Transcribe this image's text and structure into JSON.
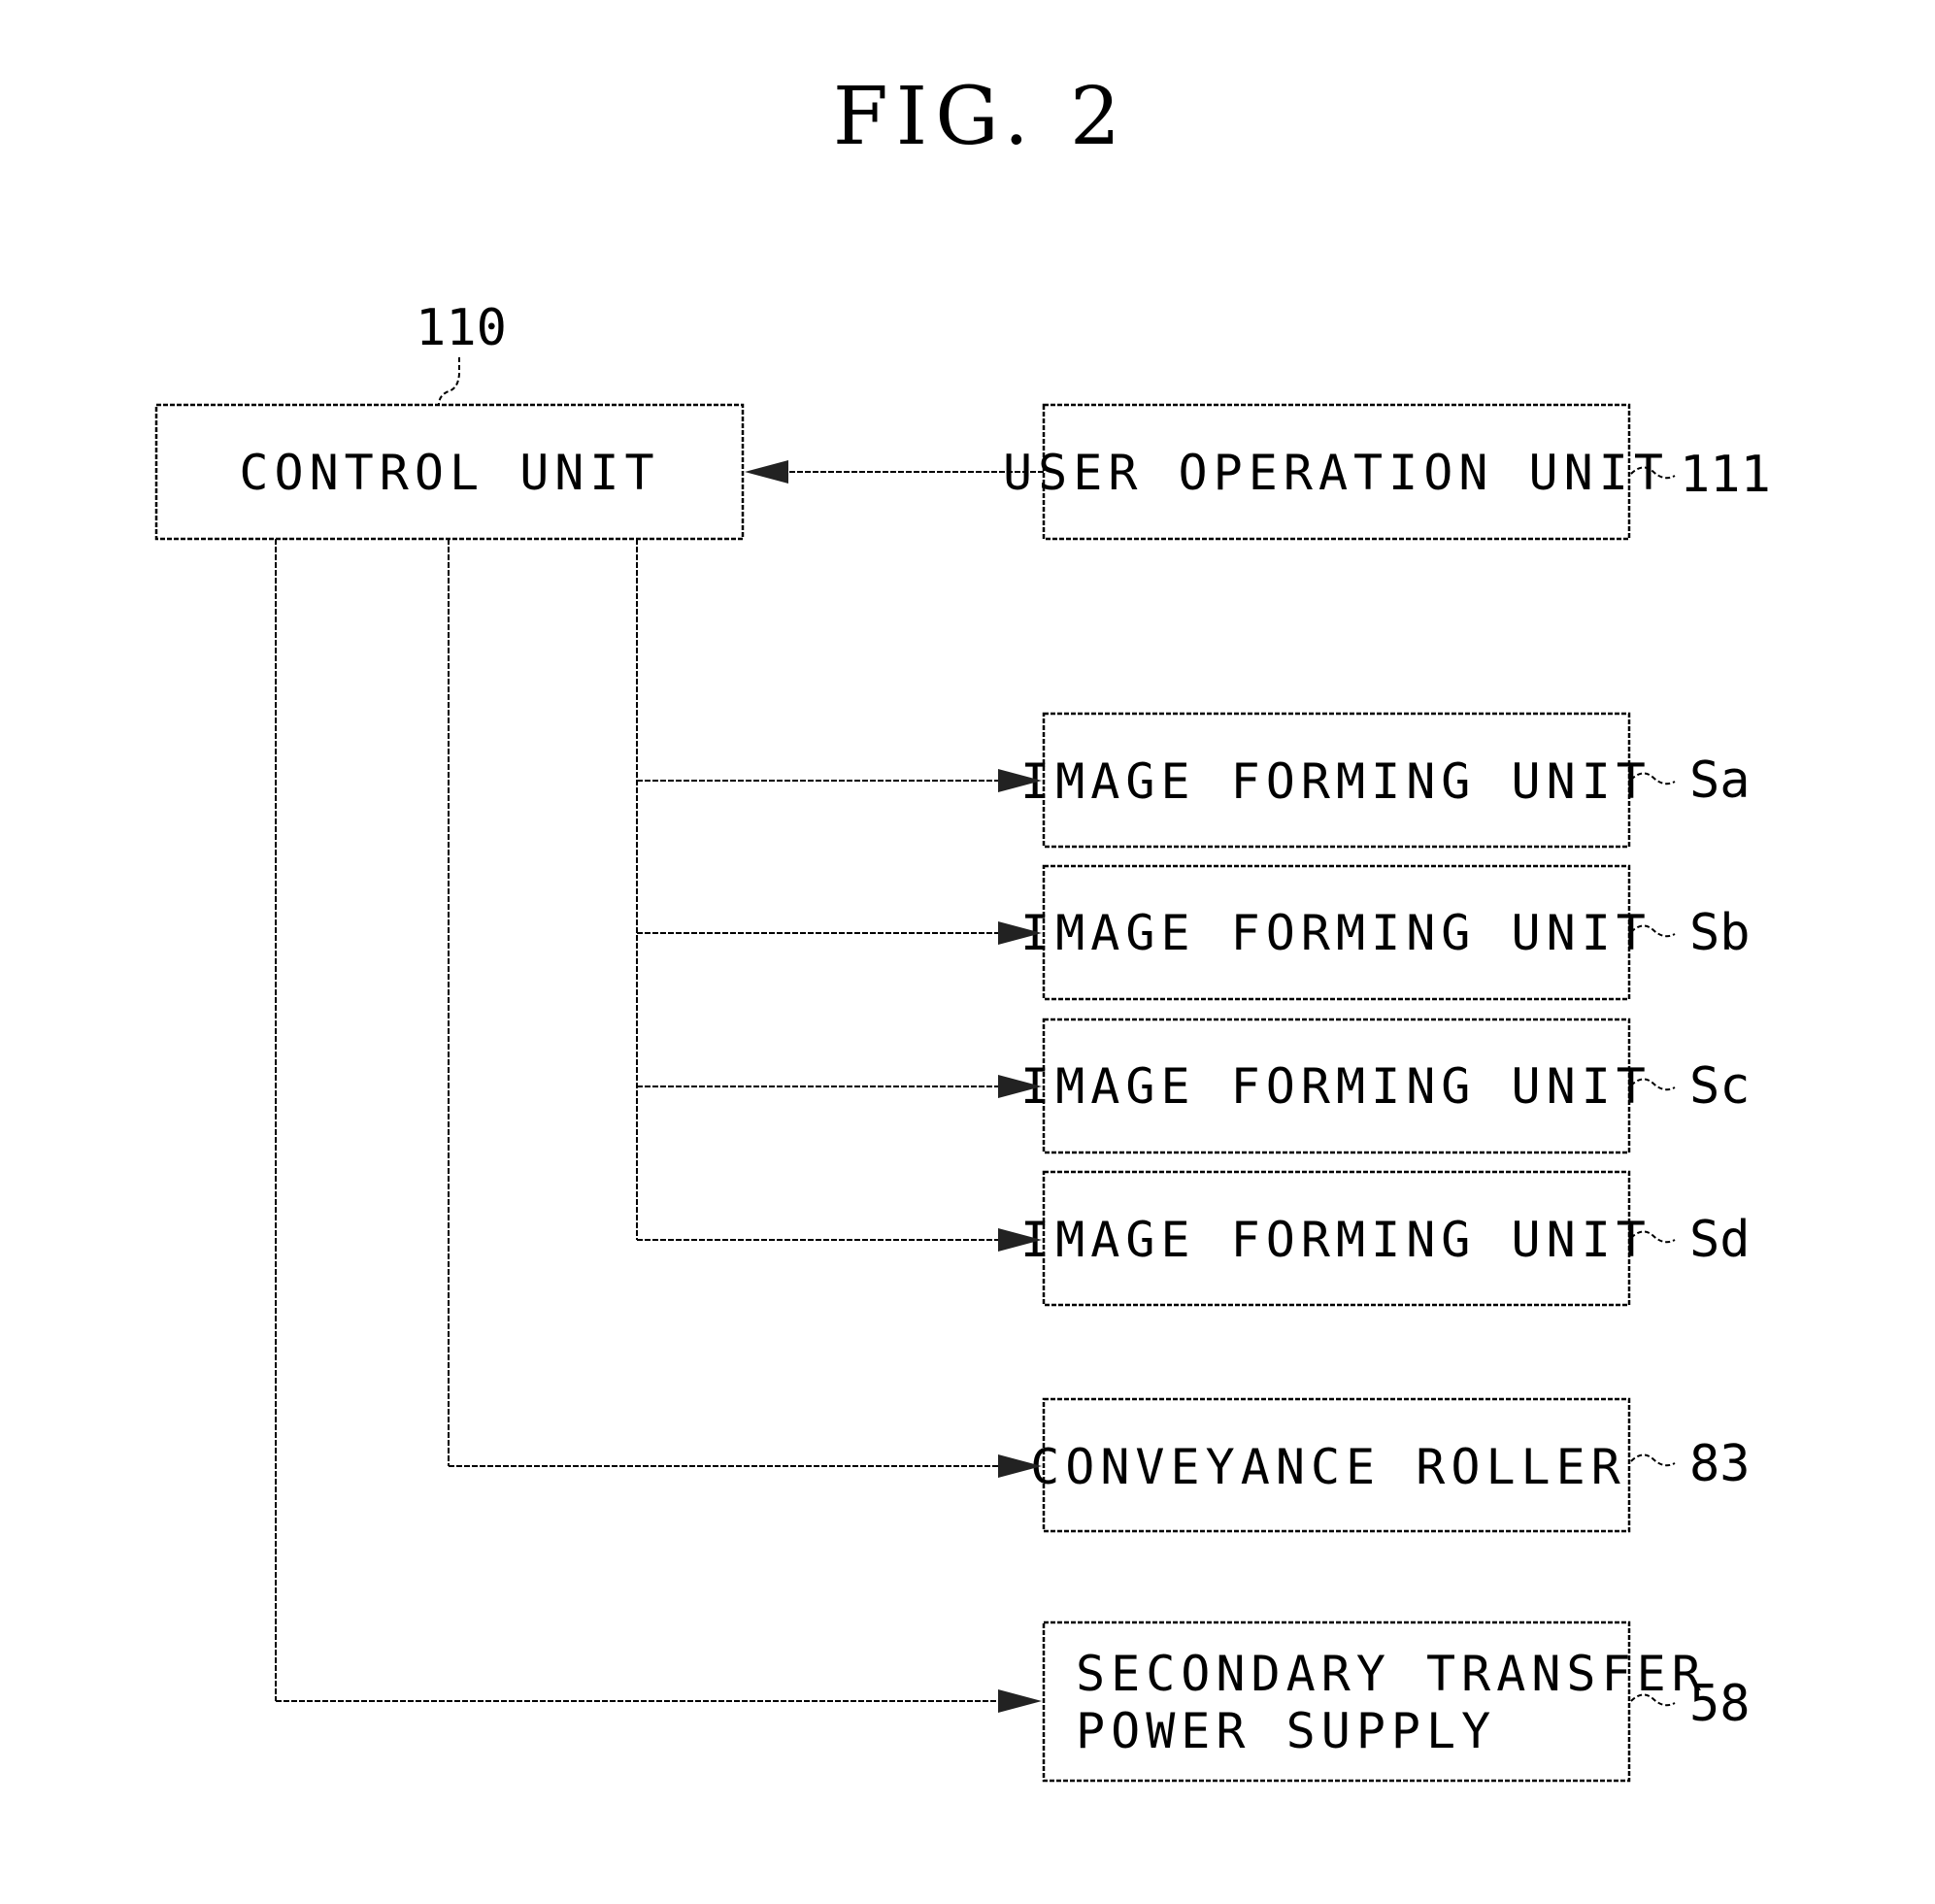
{
  "figure": {
    "title": "FIG. 2"
  },
  "control_unit": {
    "label": "CONTROL UNIT",
    "ref": "110"
  },
  "user_operation_unit": {
    "label": "USER OPERATION UNIT",
    "ref": "111"
  },
  "image_forming_units": [
    {
      "label": "IMAGE FORMING UNIT",
      "ref": "Sa"
    },
    {
      "label": "IMAGE FORMING UNIT",
      "ref": "Sb"
    },
    {
      "label": "IMAGE FORMING UNIT",
      "ref": "Sc"
    },
    {
      "label": "IMAGE FORMING UNIT",
      "ref": "Sd"
    }
  ],
  "conveyance_roller": {
    "label": "CONVEYANCE ROLLER",
    "ref": "83"
  },
  "secondary_transfer_power_supply": {
    "label_line1": "SECONDARY TRANSFER",
    "label_line2": "POWER SUPPLY",
    "ref": "58"
  },
  "connections": [
    {
      "from": "USER OPERATION UNIT",
      "to": "CONTROL UNIT"
    },
    {
      "from": "CONTROL UNIT",
      "to": "IMAGE FORMING UNIT Sa"
    },
    {
      "from": "CONTROL UNIT",
      "to": "IMAGE FORMING UNIT Sb"
    },
    {
      "from": "CONTROL UNIT",
      "to": "IMAGE FORMING UNIT Sc"
    },
    {
      "from": "CONTROL UNIT",
      "to": "IMAGE FORMING UNIT Sd"
    },
    {
      "from": "CONTROL UNIT",
      "to": "CONVEYANCE ROLLER"
    },
    {
      "from": "CONTROL UNIT",
      "to": "SECONDARY TRANSFER POWER SUPPLY"
    }
  ]
}
